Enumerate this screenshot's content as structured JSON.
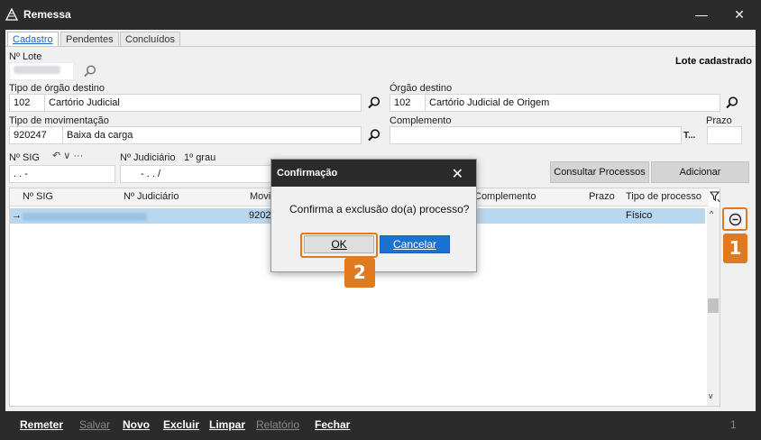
{
  "window": {
    "title": "Remessa",
    "minimize": "—",
    "close": "✕"
  },
  "tabs": [
    {
      "label": "Cadastro",
      "active": true
    },
    {
      "label": "Pendentes",
      "active": false
    },
    {
      "label": "Concluídos",
      "active": false
    }
  ],
  "form": {
    "lote_label": "Nº Lote",
    "status_text": "Lote cadastrado",
    "tipo_orgao_label": "Tipo de órgão destino",
    "tipo_orgao_code": "102",
    "tipo_orgao_name": "Cartório Judicial",
    "orgao_label": "Órgão destino",
    "orgao_code": "102",
    "orgao_name": "Cartório Judicial de Origem",
    "tipo_mov_label": "Tipo de movimentação",
    "tipo_mov_code": "920247",
    "tipo_mov_name": "Baixa da carga",
    "complemento_label": "Complemento",
    "complemento_suffix": "T...",
    "prazo_label": "Prazo",
    "sig_label": "Nº SIG",
    "sig_tools": "↶  ∨  ···",
    "sig_mask": ".    .      -",
    "judiciario_label": "Nº Judiciário",
    "grau_label": "1º grau",
    "judiciario_mask": "-    .    .    /"
  },
  "buttons": {
    "consultar": "Consultar Processos",
    "adicionar": "Adicionar"
  },
  "grid": {
    "headers": [
      "Nº SIG",
      "Nº Judiciário",
      "Movi",
      "Complemento",
      "Prazo",
      "Tipo de processo"
    ],
    "row": {
      "arrow": "→",
      "mov": "9202",
      "tipo": "Físico"
    }
  },
  "annotations": {
    "badge1": "1",
    "badge2": "2"
  },
  "dialog": {
    "title": "Confirmação",
    "message": "Confirma a exclusão do(a) processo?",
    "ok": "OK",
    "cancel": "Cancelar"
  },
  "bottombar": {
    "remeter": "Remeter",
    "salvar": "Salvar",
    "novo": "Novo",
    "excluir": "Excluir",
    "limpar": "Limpar",
    "relatorio": "Relatório",
    "fechar": "Fechar",
    "page": "1"
  },
  "colors": {
    "accent": "#e07a1f",
    "selection": "#b9d7ee",
    "primary_button": "#1a73d1",
    "dark_chrome": "#2b2b2b"
  }
}
